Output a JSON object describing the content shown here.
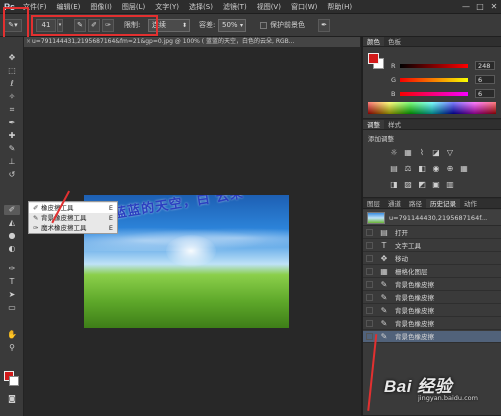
{
  "app": {
    "logo": "Ps"
  },
  "menu": [
    "文件(F)",
    "编辑(E)",
    "图像(I)",
    "图层(L)",
    "文字(Y)",
    "选择(S)",
    "滤镜(T)",
    "视图(V)",
    "窗口(W)",
    "帮助(H)"
  ],
  "window_controls": {
    "minimize": "—",
    "maximize": "□",
    "close": "✕"
  },
  "options": {
    "brush_size": "41",
    "sampling_label": "限制:",
    "limits_value": "连续",
    "tolerance_label": "容差:",
    "tolerance_value": "50%",
    "protect_fg_label": "保护前景色"
  },
  "document_tab": {
    "close": "×",
    "title": "u=791144431,2195687164&fm=21&gp=0.jpg @ 100% ( 蓝蓝的天空，白色的云朵, RGB..."
  },
  "canvas": {
    "text": "蓝蓝的天空，白 云朵"
  },
  "flyout": {
    "items": [
      {
        "label": "橡皮擦工具",
        "key": "E",
        "icon": "eraser-icon"
      },
      {
        "label": "背景橡皮擦工具",
        "key": "E",
        "icon": "background-eraser-icon"
      },
      {
        "label": "魔术橡皮擦工具",
        "key": "E",
        "icon": "magic-eraser-icon"
      }
    ]
  },
  "color_panel": {
    "tabs": [
      "颜色",
      "色板"
    ],
    "rows": [
      {
        "label": "R",
        "value": "248",
        "gradient": "linear-gradient(to right,#000000,#ff0000)"
      },
      {
        "label": "G",
        "value": "6",
        "gradient": "linear-gradient(to right,#f80000,#f8ff00)"
      },
      {
        "label": "B",
        "value": "6",
        "gradient": "linear-gradient(to right,#f80000,#f800ff)"
      }
    ],
    "foreground": "#d21a1a",
    "background": "#ffffff"
  },
  "adjust_panel": {
    "tabs": [
      "调整",
      "样式"
    ],
    "title": "添加调整"
  },
  "history_panel": {
    "tabs": [
      "图层",
      "通道",
      "路径",
      "历史记录",
      "动作"
    ],
    "snapshot": "u=791144430,2195687164f...",
    "items": [
      {
        "label": "打开",
        "icon": "document-icon"
      },
      {
        "label": "文字工具",
        "icon": "type-icon"
      },
      {
        "label": "移动",
        "icon": "move-icon"
      },
      {
        "label": "栅格化图层",
        "icon": "rasterize-icon"
      },
      {
        "label": "背景色橡皮擦",
        "icon": "bg-eraser-icon"
      },
      {
        "label": "背景色橡皮擦",
        "icon": "bg-eraser-icon"
      },
      {
        "label": "背景色橡皮擦",
        "icon": "bg-eraser-icon"
      },
      {
        "label": "背景色橡皮擦",
        "icon": "bg-eraser-icon"
      },
      {
        "label": "背景色橡皮擦",
        "icon": "bg-eraser-icon"
      }
    ]
  },
  "watermark": {
    "main": "Bai 经验",
    "sub": "jingyan.baidu.com"
  },
  "colors": {
    "annotation_red": "#e23030",
    "selected_row": "#51627a"
  }
}
